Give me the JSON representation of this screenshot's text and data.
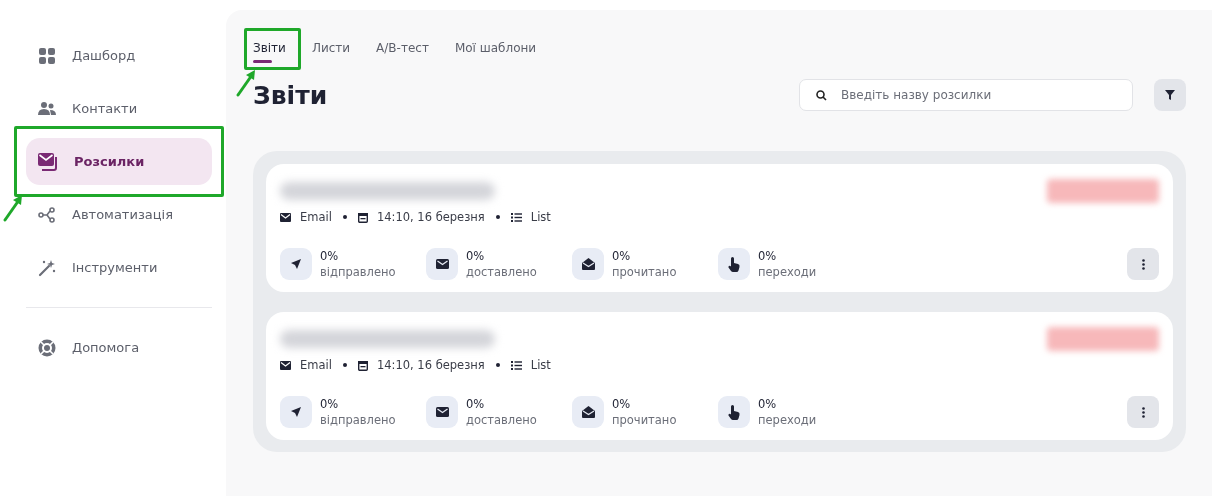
{
  "sidebar": {
    "items": [
      {
        "label": "Дашборд",
        "kind": "grid",
        "selected": false,
        "highlighted": false
      },
      {
        "label": "Контакти",
        "kind": "people",
        "selected": false,
        "highlighted": false
      },
      {
        "label": "Розсилки",
        "kind": "mail",
        "selected": true,
        "highlighted": true
      },
      {
        "label": "Автоматизація",
        "kind": "share",
        "selected": false,
        "highlighted": false
      },
      {
        "label": "Інструменти",
        "kind": "wand",
        "selected": false,
        "highlighted": false
      },
      {
        "label": "Допомога",
        "kind": "help",
        "selected": false,
        "highlighted": false,
        "separated": true
      }
    ]
  },
  "tabs": [
    {
      "label": "Звіти",
      "selected": true,
      "highlighted": true
    },
    {
      "label": "Листи",
      "selected": false,
      "highlighted": false
    },
    {
      "label": "А/В-тест",
      "selected": false,
      "highlighted": false
    },
    {
      "label": "Мої шаблони",
      "selected": false,
      "highlighted": false
    }
  ],
  "page_title": "Звіти",
  "search": {
    "placeholder": "Введіть назву розсилки"
  },
  "campaigns": [
    {
      "title_redacted": true,
      "status_redacted": true,
      "channel": "Email",
      "date": "14:10, 16 березня",
      "list": "List",
      "stats": [
        {
          "kind": "sent",
          "value": "0%",
          "label": "відправлено"
        },
        {
          "kind": "delivered",
          "value": "0%",
          "label": "доставлено"
        },
        {
          "kind": "read",
          "value": "0%",
          "label": "прочитано"
        },
        {
          "kind": "clicks",
          "value": "0%",
          "label": "переходи"
        }
      ]
    },
    {
      "title_redacted": true,
      "status_redacted": true,
      "channel": "Email",
      "date": "14:10, 16 березня",
      "list": "List",
      "stats": [
        {
          "kind": "sent",
          "value": "0%",
          "label": "відправлено"
        },
        {
          "kind": "delivered",
          "value": "0%",
          "label": "доставлено"
        },
        {
          "kind": "read",
          "value": "0%",
          "label": "прочитано"
        },
        {
          "kind": "clicks",
          "value": "0%",
          "label": "переходи"
        }
      ]
    }
  ]
}
